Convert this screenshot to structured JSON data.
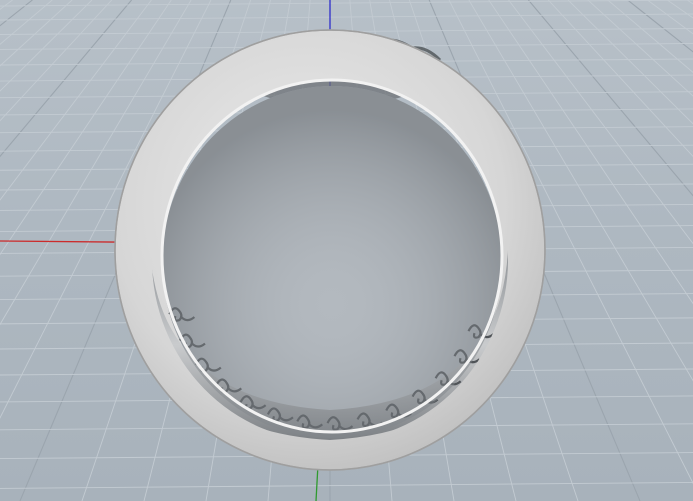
{
  "viewport": {
    "view_name": "Perspective",
    "background_color": "#aeb8c1",
    "grid_color": "#c3cbd2",
    "grid_major_color": "#9ba5ae",
    "x_axis_color": "#cc2b2b",
    "y_axis_color": "#2f9a2f",
    "z_axis_color": "#2f2fcc"
  },
  "model": {
    "object": "ring",
    "material_color": "#d8d8d8",
    "edge_color": "#b4b4b4",
    "inner_pattern": "filigree-scroll"
  }
}
